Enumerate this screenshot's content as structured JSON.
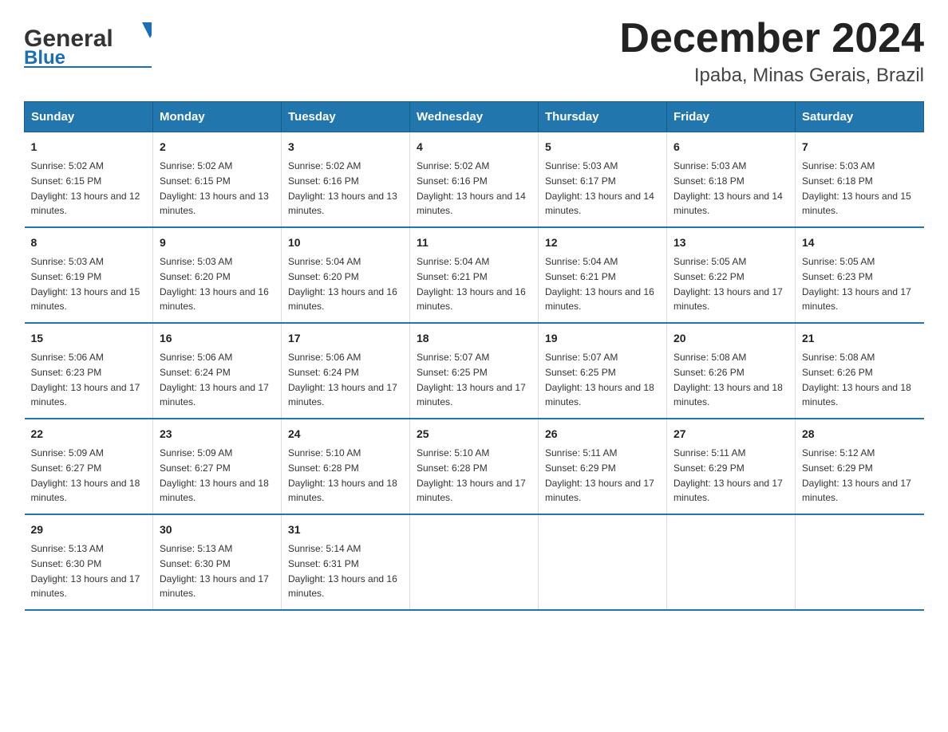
{
  "header": {
    "logo_general": "General",
    "logo_blue": "Blue",
    "title": "December 2024",
    "subtitle": "Ipaba, Minas Gerais, Brazil"
  },
  "weekdays": [
    "Sunday",
    "Monday",
    "Tuesday",
    "Wednesday",
    "Thursday",
    "Friday",
    "Saturday"
  ],
  "weeks": [
    [
      {
        "day": "1",
        "sunrise": "5:02 AM",
        "sunset": "6:15 PM",
        "daylight": "13 hours and 12 minutes."
      },
      {
        "day": "2",
        "sunrise": "5:02 AM",
        "sunset": "6:15 PM",
        "daylight": "13 hours and 13 minutes."
      },
      {
        "day": "3",
        "sunrise": "5:02 AM",
        "sunset": "6:16 PM",
        "daylight": "13 hours and 13 minutes."
      },
      {
        "day": "4",
        "sunrise": "5:02 AM",
        "sunset": "6:16 PM",
        "daylight": "13 hours and 14 minutes."
      },
      {
        "day": "5",
        "sunrise": "5:03 AM",
        "sunset": "6:17 PM",
        "daylight": "13 hours and 14 minutes."
      },
      {
        "day": "6",
        "sunrise": "5:03 AM",
        "sunset": "6:18 PM",
        "daylight": "13 hours and 14 minutes."
      },
      {
        "day": "7",
        "sunrise": "5:03 AM",
        "sunset": "6:18 PM",
        "daylight": "13 hours and 15 minutes."
      }
    ],
    [
      {
        "day": "8",
        "sunrise": "5:03 AM",
        "sunset": "6:19 PM",
        "daylight": "13 hours and 15 minutes."
      },
      {
        "day": "9",
        "sunrise": "5:03 AM",
        "sunset": "6:20 PM",
        "daylight": "13 hours and 16 minutes."
      },
      {
        "day": "10",
        "sunrise": "5:04 AM",
        "sunset": "6:20 PM",
        "daylight": "13 hours and 16 minutes."
      },
      {
        "day": "11",
        "sunrise": "5:04 AM",
        "sunset": "6:21 PM",
        "daylight": "13 hours and 16 minutes."
      },
      {
        "day": "12",
        "sunrise": "5:04 AM",
        "sunset": "6:21 PM",
        "daylight": "13 hours and 16 minutes."
      },
      {
        "day": "13",
        "sunrise": "5:05 AM",
        "sunset": "6:22 PM",
        "daylight": "13 hours and 17 minutes."
      },
      {
        "day": "14",
        "sunrise": "5:05 AM",
        "sunset": "6:23 PM",
        "daylight": "13 hours and 17 minutes."
      }
    ],
    [
      {
        "day": "15",
        "sunrise": "5:06 AM",
        "sunset": "6:23 PM",
        "daylight": "13 hours and 17 minutes."
      },
      {
        "day": "16",
        "sunrise": "5:06 AM",
        "sunset": "6:24 PM",
        "daylight": "13 hours and 17 minutes."
      },
      {
        "day": "17",
        "sunrise": "5:06 AM",
        "sunset": "6:24 PM",
        "daylight": "13 hours and 17 minutes."
      },
      {
        "day": "18",
        "sunrise": "5:07 AM",
        "sunset": "6:25 PM",
        "daylight": "13 hours and 17 minutes."
      },
      {
        "day": "19",
        "sunrise": "5:07 AM",
        "sunset": "6:25 PM",
        "daylight": "13 hours and 18 minutes."
      },
      {
        "day": "20",
        "sunrise": "5:08 AM",
        "sunset": "6:26 PM",
        "daylight": "13 hours and 18 minutes."
      },
      {
        "day": "21",
        "sunrise": "5:08 AM",
        "sunset": "6:26 PM",
        "daylight": "13 hours and 18 minutes."
      }
    ],
    [
      {
        "day": "22",
        "sunrise": "5:09 AM",
        "sunset": "6:27 PM",
        "daylight": "13 hours and 18 minutes."
      },
      {
        "day": "23",
        "sunrise": "5:09 AM",
        "sunset": "6:27 PM",
        "daylight": "13 hours and 18 minutes."
      },
      {
        "day": "24",
        "sunrise": "5:10 AM",
        "sunset": "6:28 PM",
        "daylight": "13 hours and 18 minutes."
      },
      {
        "day": "25",
        "sunrise": "5:10 AM",
        "sunset": "6:28 PM",
        "daylight": "13 hours and 17 minutes."
      },
      {
        "day": "26",
        "sunrise": "5:11 AM",
        "sunset": "6:29 PM",
        "daylight": "13 hours and 17 minutes."
      },
      {
        "day": "27",
        "sunrise": "5:11 AM",
        "sunset": "6:29 PM",
        "daylight": "13 hours and 17 minutes."
      },
      {
        "day": "28",
        "sunrise": "5:12 AM",
        "sunset": "6:29 PM",
        "daylight": "13 hours and 17 minutes."
      }
    ],
    [
      {
        "day": "29",
        "sunrise": "5:13 AM",
        "sunset": "6:30 PM",
        "daylight": "13 hours and 17 minutes."
      },
      {
        "day": "30",
        "sunrise": "5:13 AM",
        "sunset": "6:30 PM",
        "daylight": "13 hours and 17 minutes."
      },
      {
        "day": "31",
        "sunrise": "5:14 AM",
        "sunset": "6:31 PM",
        "daylight": "13 hours and 16 minutes."
      },
      {
        "day": "",
        "sunrise": "",
        "sunset": "",
        "daylight": ""
      },
      {
        "day": "",
        "sunrise": "",
        "sunset": "",
        "daylight": ""
      },
      {
        "day": "",
        "sunrise": "",
        "sunset": "",
        "daylight": ""
      },
      {
        "day": "",
        "sunrise": "",
        "sunset": "",
        "daylight": ""
      }
    ]
  ],
  "labels": {
    "sunrise": "Sunrise: ",
    "sunset": "Sunset: ",
    "daylight": "Daylight: "
  }
}
